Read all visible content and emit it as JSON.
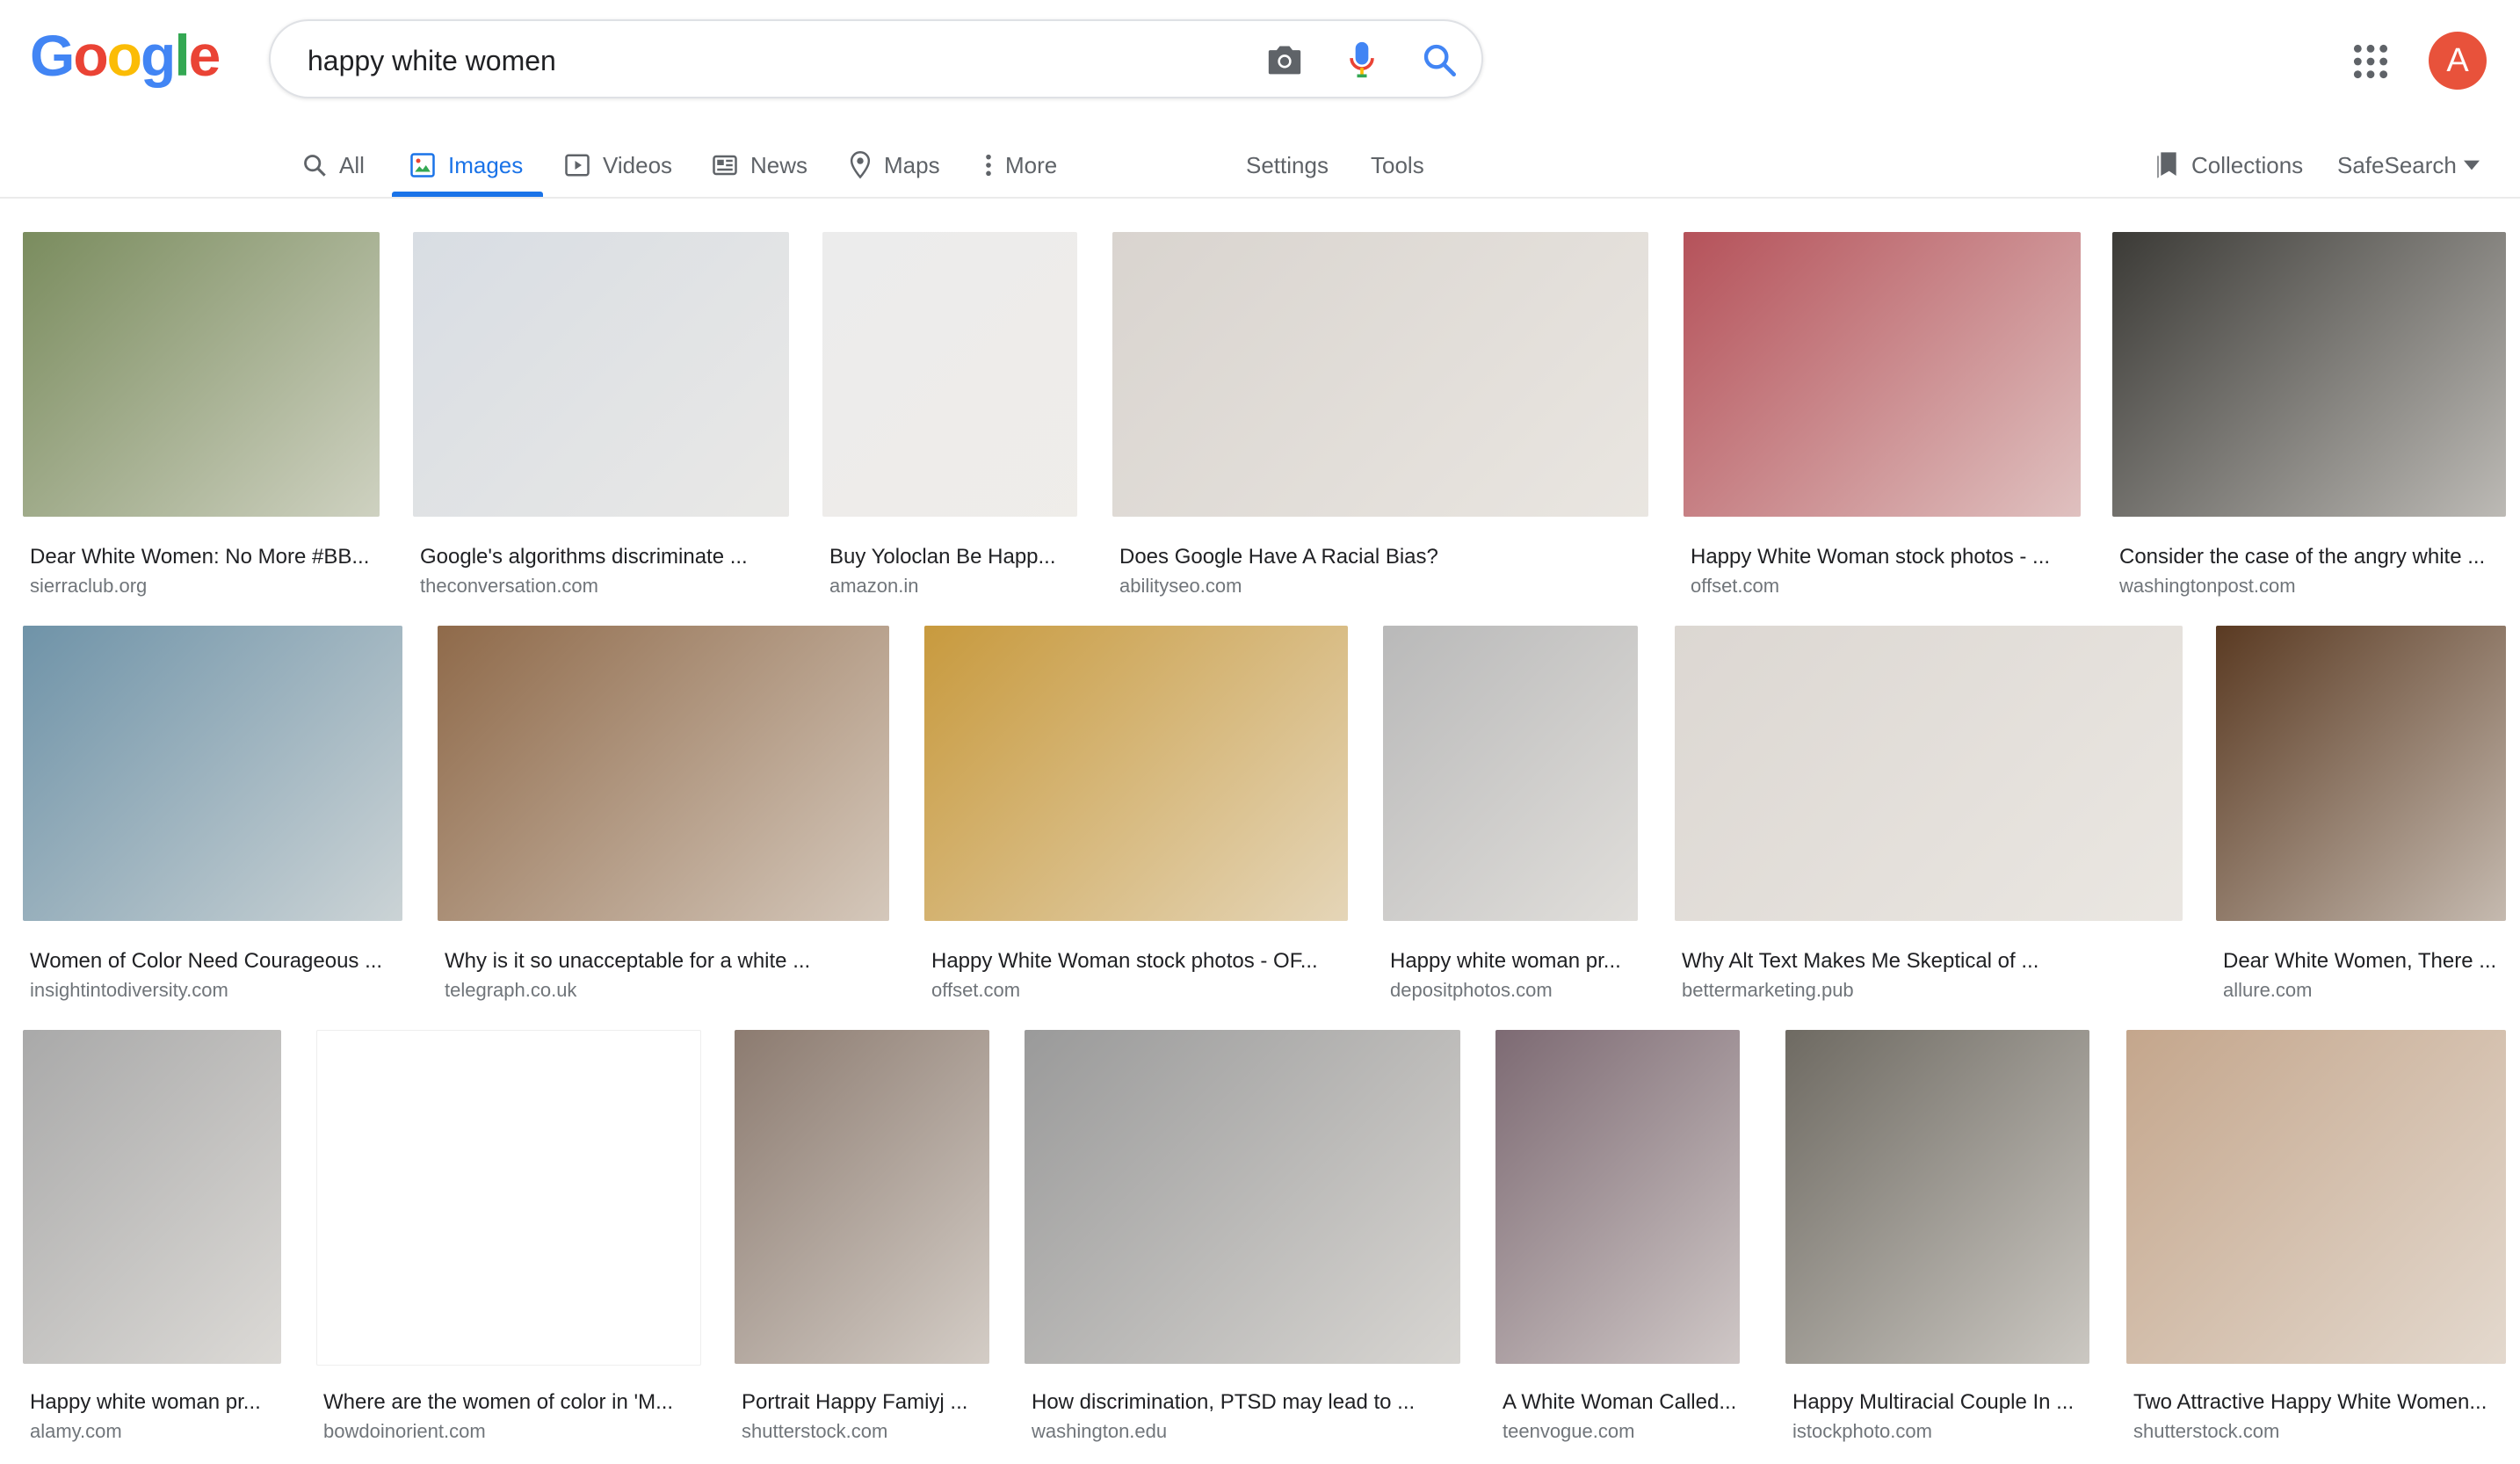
{
  "search": {
    "query": "happy white women"
  },
  "logo": {
    "letters": [
      "G",
      "o",
      "o",
      "g",
      "l",
      "e"
    ],
    "colors": [
      "#4285f4",
      "#ea4335",
      "#fbbc05",
      "#4285f4",
      "#34a853",
      "#ea4335"
    ]
  },
  "user": {
    "initial": "A",
    "color": "#e8523b"
  },
  "tabs": {
    "all": "All",
    "images": "Images",
    "videos": "Videos",
    "news": "News",
    "maps": "Maps",
    "more": "More",
    "settings": "Settings",
    "tools": "Tools",
    "collections": "Collections",
    "safesearch": "SafeSearch"
  },
  "results": [
    {
      "title": "Dear White Women: No More #BB...",
      "source": "sierraclub.org",
      "color": "#7a8c5e"
    },
    {
      "title": "Google's algorithms discriminate ...",
      "source": "theconversation.com",
      "color": "#d8dde3"
    },
    {
      "title": "Buy Yoloclan Be Happ...",
      "source": "amazon.in",
      "color": "#ececec"
    },
    {
      "title": "Does Google Have A Racial Bias?",
      "source": "abilityseo.com",
      "color": "#d9d4cf"
    },
    {
      "title": "Happy White Woman stock photos - ...",
      "source": "offset.com",
      "color": "#b5525a"
    },
    {
      "title": "Consider the case of the angry white ...",
      "source": "washingtonpost.com",
      "color": "#3b3a36"
    },
    {
      "title": "Women of Color Need Courageous ...",
      "source": "insightintodiversity.com",
      "color": "#6f93a8"
    },
    {
      "title": "Why is it so unacceptable for a white ...",
      "source": "telegraph.co.uk",
      "color": "#8f6a4a"
    },
    {
      "title": "Happy White Woman stock photos - OF...",
      "source": "offset.com",
      "color": "#c89a3e"
    },
    {
      "title": "Happy white woman pr...",
      "source": "depositphotos.com",
      "color": "#b9b9b9"
    },
    {
      "title": "Why Alt Text Makes Me Skeptical of ...",
      "source": "bettermarketing.pub",
      "color": "#dcd7d2"
    },
    {
      "title": "Dear White Women, There ...",
      "source": "allure.com",
      "color": "#5a3a22"
    },
    {
      "title": "Happy white woman pr...",
      "source": "alamy.com",
      "color": "#a9a9a9"
    },
    {
      "title": "Where are the women of color in 'M...",
      "source": "bowdoinorient.com",
      "color": "#ffffff"
    },
    {
      "title": "Portrait Happy Famiyj ...",
      "source": "shutterstock.com",
      "color": "#8c7b70"
    },
    {
      "title": "How discrimination, PTSD may lead to ...",
      "source": "washington.edu",
      "color": "#9a9a9a"
    },
    {
      "title": "A White Woman Called...",
      "source": "teenvogue.com",
      "color": "#7d6a73"
    },
    {
      "title": "Happy Multiracial Couple In ...",
      "source": "istockphoto.com",
      "color": "#6e6a62"
    },
    {
      "title": "Two Attractive Happy White Women...",
      "source": "shutterstock.com",
      "color": "#c4a68c"
    }
  ]
}
